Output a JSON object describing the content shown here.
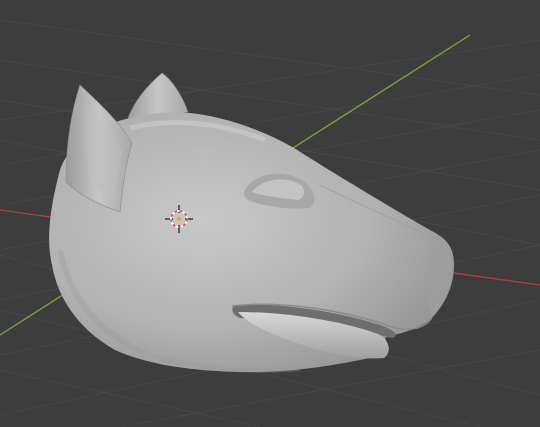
{
  "viewport": {
    "background_color": "#3d3d3d",
    "grid_line_color": "#484848",
    "x_axis_color": "#b0414e",
    "y_axis_color": "#7fa63a",
    "model_color": "#b9b9b9",
    "cursor_icon": "3d-cursor-icon"
  }
}
